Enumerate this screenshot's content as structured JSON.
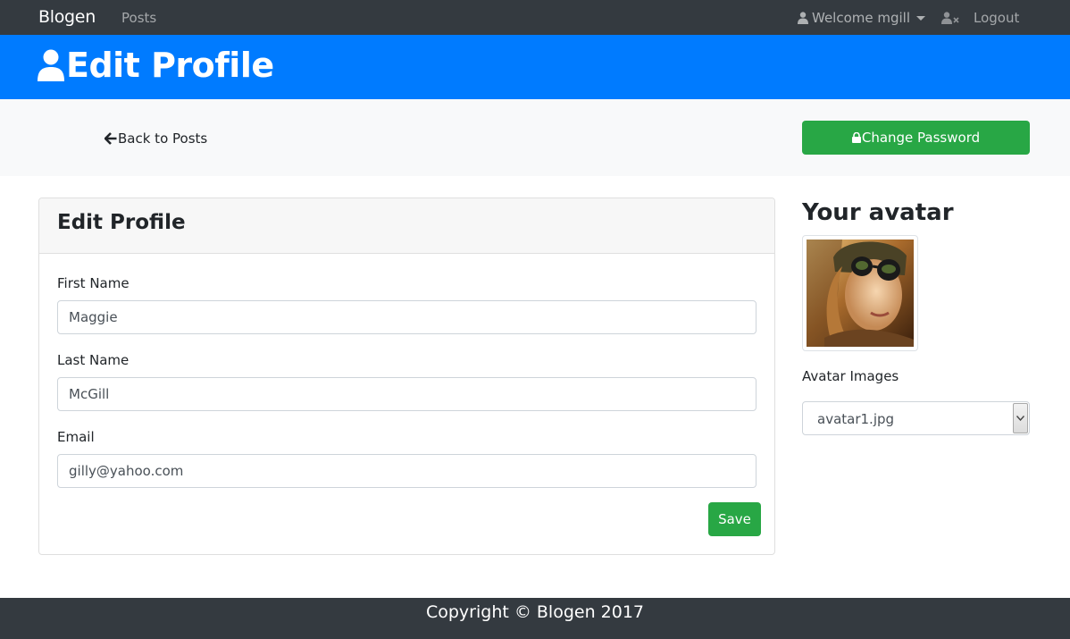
{
  "navbar": {
    "brand": "Blogen",
    "posts_link": "Posts",
    "welcome": "Welcome mgill",
    "logout": "Logout"
  },
  "header": {
    "title": "Edit Profile",
    "icon": "user-icon",
    "bg_color": "#007bff"
  },
  "actions": {
    "back_link": "Back to Posts",
    "change_password": "Change Password",
    "button_color": "#28a745"
  },
  "form": {
    "title": "Edit Profile",
    "fields": [
      {
        "label": "First Name",
        "value": "Maggie"
      },
      {
        "label": "Last Name",
        "value": "McGill"
      },
      {
        "label": "Email",
        "value": "gilly@yahoo.com"
      }
    ],
    "save_label": "Save"
  },
  "avatar": {
    "heading": "Your avatar",
    "images_label": "Avatar Images",
    "selected": "avatar1.jpg"
  },
  "footer": {
    "text": "Copyright © Blogen 2017"
  }
}
